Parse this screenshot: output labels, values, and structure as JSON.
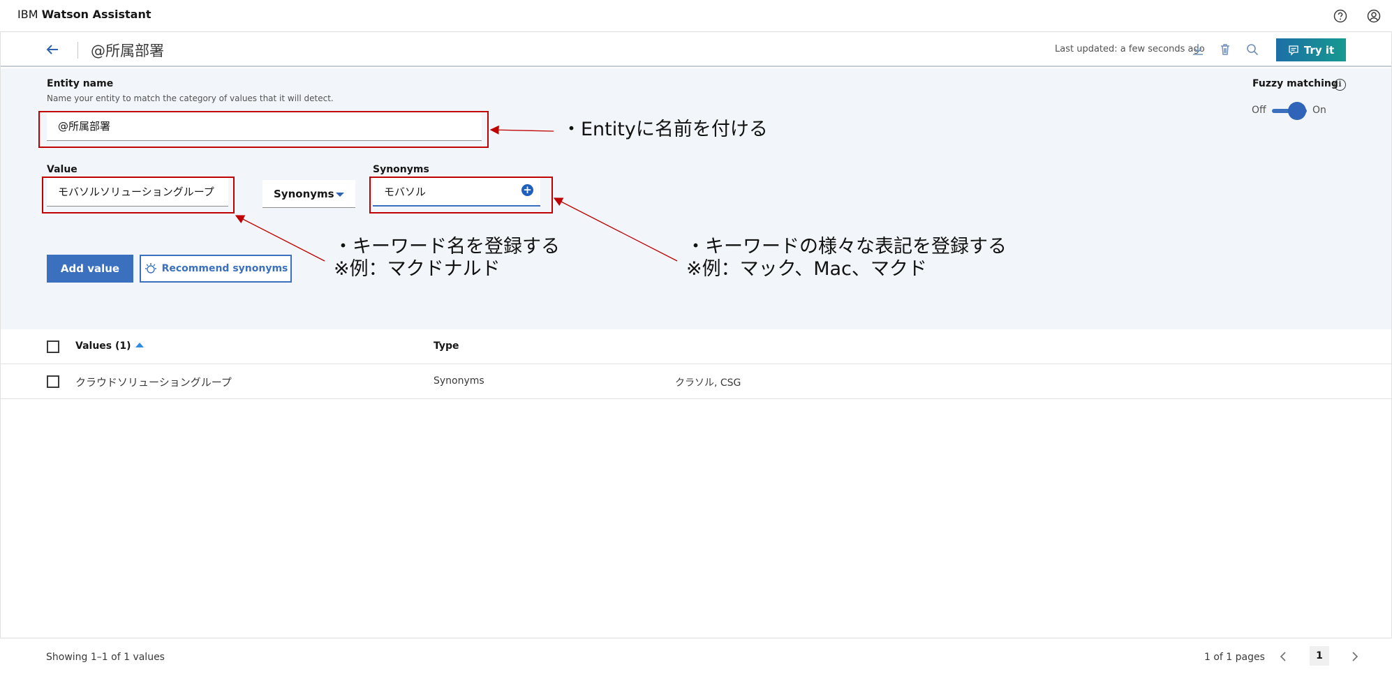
{
  "app": {
    "brand_prefix": "IBM",
    "brand_name": "Watson Assistant"
  },
  "header": {
    "title": "@所属部署",
    "last_updated": "Last updated: a few seconds ago",
    "try_label": "Try it"
  },
  "entity": {
    "name_label": "Entity name",
    "name_help": "Name your entity to match the category of values that it will detect.",
    "name_value": "@所属部署"
  },
  "fuzzy": {
    "label": "Fuzzy matching",
    "off_label": "Off",
    "on_label": "On",
    "state": "on"
  },
  "value_form": {
    "value_label": "Value",
    "value_input": "モバソルソリューショングループ",
    "type_selected": "Synonyms",
    "synonyms_label": "Synonyms",
    "synonyms_input": "モバソル",
    "add_label": "Add value",
    "recommend_label": "Recommend synonyms"
  },
  "annotations": {
    "entity_name": "・Entityに名前を付ける",
    "keyword_line1": "・キーワード名を登録する",
    "keyword_line2": "※例：マクドナルド",
    "synonym_line1": "・キーワードの様々な表記を登録する",
    "synonym_line2": "※例：マック、Mac、マクド"
  },
  "table": {
    "header_values": "Values (1)",
    "header_type": "Type",
    "rows": [
      {
        "value": "クラウドソリューショングループ",
        "type": "Synonyms",
        "synonyms": "クラソル, CSG"
      }
    ]
  },
  "footer": {
    "showing": "Showing 1–1 of 1 values",
    "pages": "1 of 1 pages",
    "current_page": "1"
  },
  "colors": {
    "accent": "#3b70bf",
    "annotation_red": "#c00000",
    "form_bg": "#f2f5f9"
  }
}
